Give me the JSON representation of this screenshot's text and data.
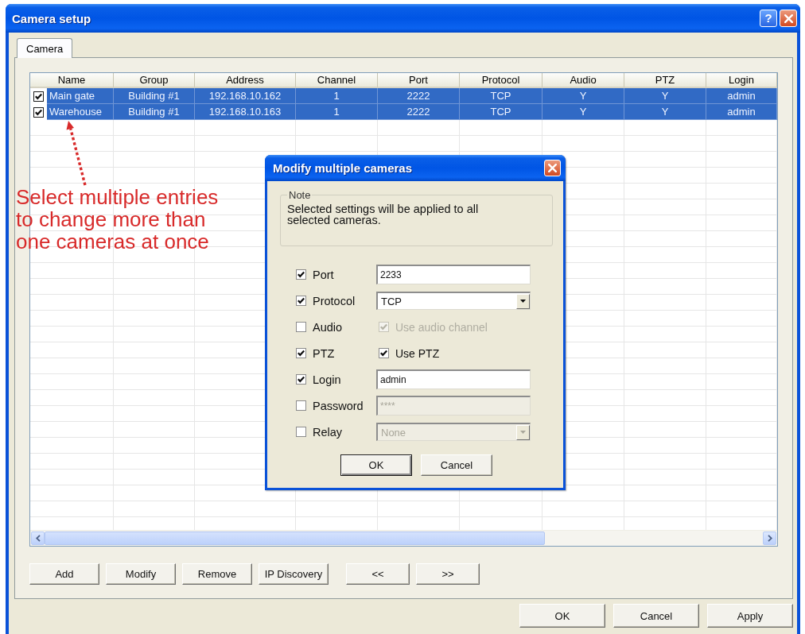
{
  "window": {
    "title": "Camera setup",
    "help_button": "?"
  },
  "tabs": [
    {
      "label": "Camera",
      "selected": true
    }
  ],
  "table": {
    "columns": [
      "Name",
      "Group",
      "Address",
      "Channel",
      "Port",
      "Protocol",
      "Audio",
      "PTZ",
      "Login"
    ],
    "rows": [
      {
        "checked": true,
        "selected": true,
        "cells": [
          "Main gate",
          "Building #1",
          "192.168.10.162",
          "1",
          "2222",
          "TCP",
          "Y",
          "Y",
          "admin"
        ]
      },
      {
        "checked": true,
        "selected": true,
        "cells": [
          "Warehouse",
          "Building #1",
          "192.168.10.163",
          "1",
          "2222",
          "TCP",
          "Y",
          "Y",
          "admin"
        ]
      }
    ]
  },
  "annotation": {
    "text": "Select multiple entries to change more than one cameras at once"
  },
  "toolbar": {
    "actions": [
      "Add",
      "Modify",
      "Remove",
      "IP Discovery"
    ],
    "paging": [
      "<<",
      ">>"
    ]
  },
  "dialog": {
    "title": "Modify multiple cameras",
    "note": {
      "label": "Note",
      "text": "Selected settings will be applied to all selected cameras."
    },
    "fields": [
      {
        "label": "Port",
        "checked": true,
        "kind": "text",
        "value": "2233",
        "disabled": false
      },
      {
        "label": "Protocol",
        "checked": true,
        "kind": "select",
        "value": "TCP",
        "disabled": false
      },
      {
        "label": "Audio",
        "checked": false,
        "kind": "checkbox",
        "option": "Use audio channel",
        "option_checked": true,
        "disabled": true
      },
      {
        "label": "PTZ",
        "checked": true,
        "kind": "checkbox",
        "option": "Use PTZ",
        "option_checked": true,
        "disabled": false
      },
      {
        "label": "Login",
        "checked": true,
        "kind": "text",
        "value": "admin",
        "disabled": false
      },
      {
        "label": "Password",
        "checked": false,
        "kind": "text",
        "value": "****",
        "disabled": true
      },
      {
        "label": "Relay",
        "checked": false,
        "kind": "select",
        "value": "None",
        "disabled": true
      }
    ],
    "buttons": [
      {
        "label": "OK",
        "default": true
      },
      {
        "label": "Cancel",
        "default": false
      }
    ]
  },
  "buttons": [
    "OK",
    "Cancel",
    "Apply"
  ]
}
